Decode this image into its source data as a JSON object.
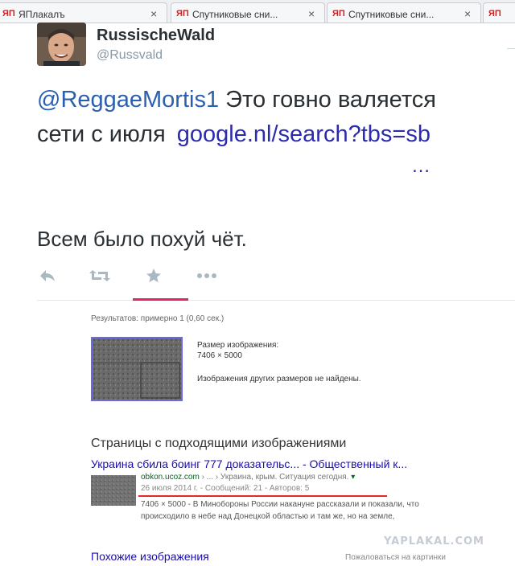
{
  "browser": {
    "tabs": [
      {
        "favicon": "ЯП",
        "title": "ЯПлакалъ",
        "close": "×"
      },
      {
        "favicon": "ЯП",
        "title": "Спутниковые сни...",
        "close": "×"
      },
      {
        "favicon": "ЯП",
        "title": "Спутниковые сни...",
        "close": "×"
      },
      {
        "favicon": "ЯП",
        "title": "",
        "close": ""
      }
    ]
  },
  "tweet": {
    "author_name": "RussischeWald",
    "author_handle": "@Russvald",
    "mention": "@ReggaeMortis1",
    "text_line1": " Это говно валяется",
    "text_line2_prefix": "сети с июля ",
    "link": "google.nl/search?tbs=sb",
    "ellipsis": "…",
    "reply_text": "Всем было похуй чёт.",
    "actions": {
      "reply_icon": "reply-icon",
      "retweet_icon": "retweet-icon",
      "favorite_icon": "star-icon",
      "more_icon": "more-icon"
    }
  },
  "google_result": {
    "results_count": "Результатов: примерно 1 (0,60 сек.)",
    "image_size_label": "Размер изображения:",
    "image_size_value": "7406 × 5000",
    "no_other_sizes": "Изображения других размеров не найдены.",
    "pages_heading": "Страницы с подходящими изображениями",
    "result_title": "Украина сбила боинг 777 доказательс... - Общественный к...",
    "result_url": "obkon.ucoz.com",
    "result_url_path": " › ... › Украина, крым. Ситуация сегодня.",
    "result_url_arrow": " ▾",
    "result_meta": "26 июля 2014 г. - Сообщений: 21 - Авторов: 5",
    "snippet_line1": "7406 × 5000 - В Минобороны России накануне рассказали и показали, что",
    "snippet_line2": "происходило в небе над Донецкой областью и там же, но на земле,",
    "similar_images": "Похожие изображения",
    "report_link": "Пожаловаться на картинки"
  },
  "watermark": "YAPLAKAL.COM",
  "colors": {
    "mention": "#2b5fb0",
    "link": "#2b2bb0",
    "google_link": "#1a0dab",
    "red_underline": "#e52727",
    "tab_favicon": "#d81e1e"
  }
}
